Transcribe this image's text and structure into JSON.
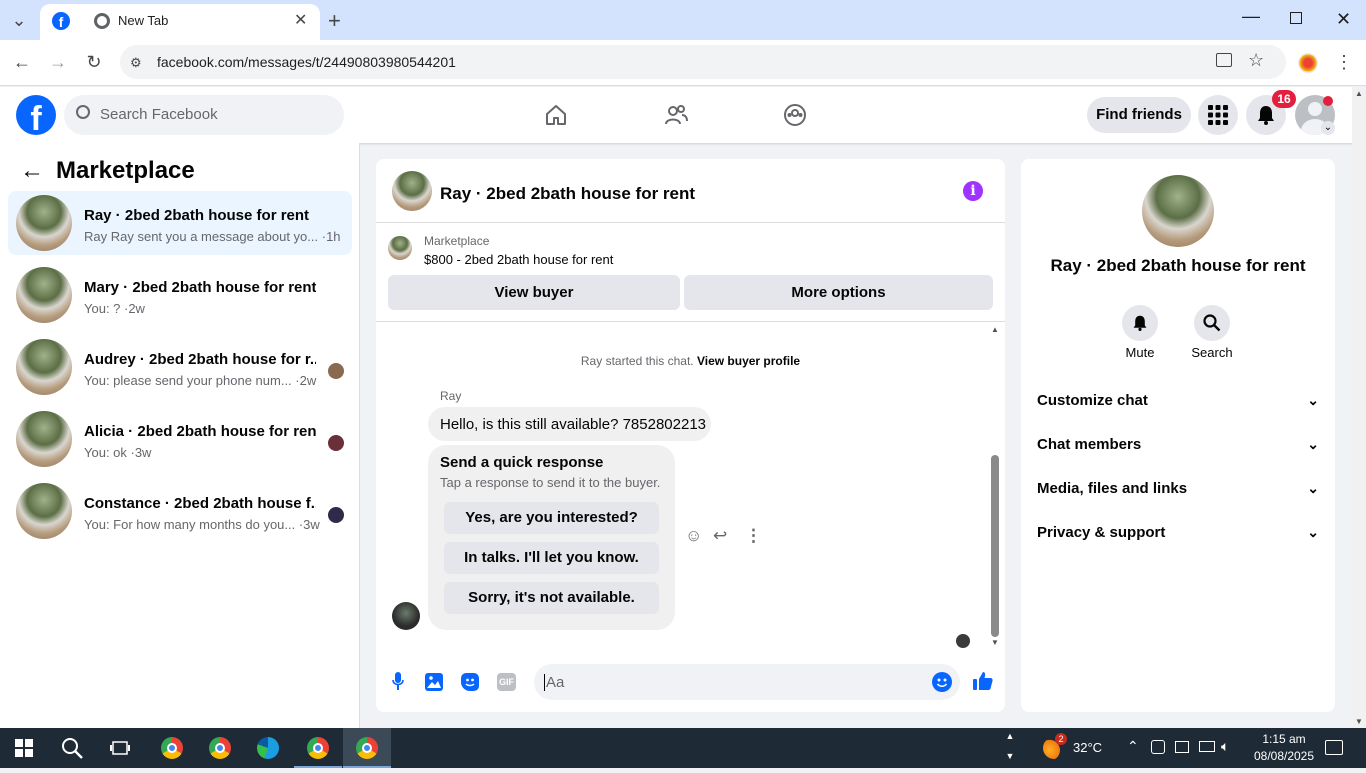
{
  "browser": {
    "tab_title": "New Tab",
    "url": "facebook.com/messages/t/24490803980544201"
  },
  "header": {
    "logo_letter": "f",
    "search_placeholder": "Search Facebook",
    "find_friends": "Find friends",
    "notification_count": "16"
  },
  "left": {
    "title": "Marketplace",
    "conversations": [
      {
        "title": "Ray · 2bed 2bath house for rent",
        "subtitle": "Ray Ray sent you a message about yo... ·1h"
      },
      {
        "title": "Mary · 2bed 2bath house for rent",
        "subtitle": "You: ? ·2w"
      },
      {
        "title": "Audrey · 2bed 2bath house for r...",
        "subtitle": "You: please send your phone num... ·2w"
      },
      {
        "title": "Alicia · 2bed 2bath house for rent",
        "subtitle": "You: ok ·3w"
      },
      {
        "title": "Constance · 2bed 2bath house f...",
        "subtitle": "You: For how many months do you... ·3w"
      }
    ]
  },
  "chat": {
    "title": "Ray · 2bed 2bath house for rent",
    "listing_source": "Marketplace",
    "listing_title": "$800 - 2bed 2bath house for rent",
    "view_buyer": "View buyer",
    "more_options": "More options",
    "started_text": "Ray started this chat.",
    "view_buyer_profile": "View buyer profile",
    "sender": "Ray",
    "message": "Hello, is this still available? 7852802213",
    "quick_title": "Send a quick response",
    "quick_subtitle": "Tap a response to send it to the buyer.",
    "quick_responses": [
      "Yes, are you interested?",
      "In talks. I'll let you know.",
      "Sorry, it's not available."
    ],
    "composer_placeholder": "Aa"
  },
  "right": {
    "title": "Ray · 2bed 2bath house for rent",
    "mute": "Mute",
    "search": "Search",
    "sections": [
      "Customize chat",
      "Chat members",
      "Media, files and links",
      "Privacy & support"
    ]
  },
  "taskbar": {
    "weather_badge": "2",
    "temperature": "32°C",
    "time": "1:15 am",
    "date": "08/08/2025"
  },
  "colors": {
    "fb_blue": "#0866ff",
    "messenger_purple": "#a033ff",
    "notification_red": "#e41e3f"
  }
}
